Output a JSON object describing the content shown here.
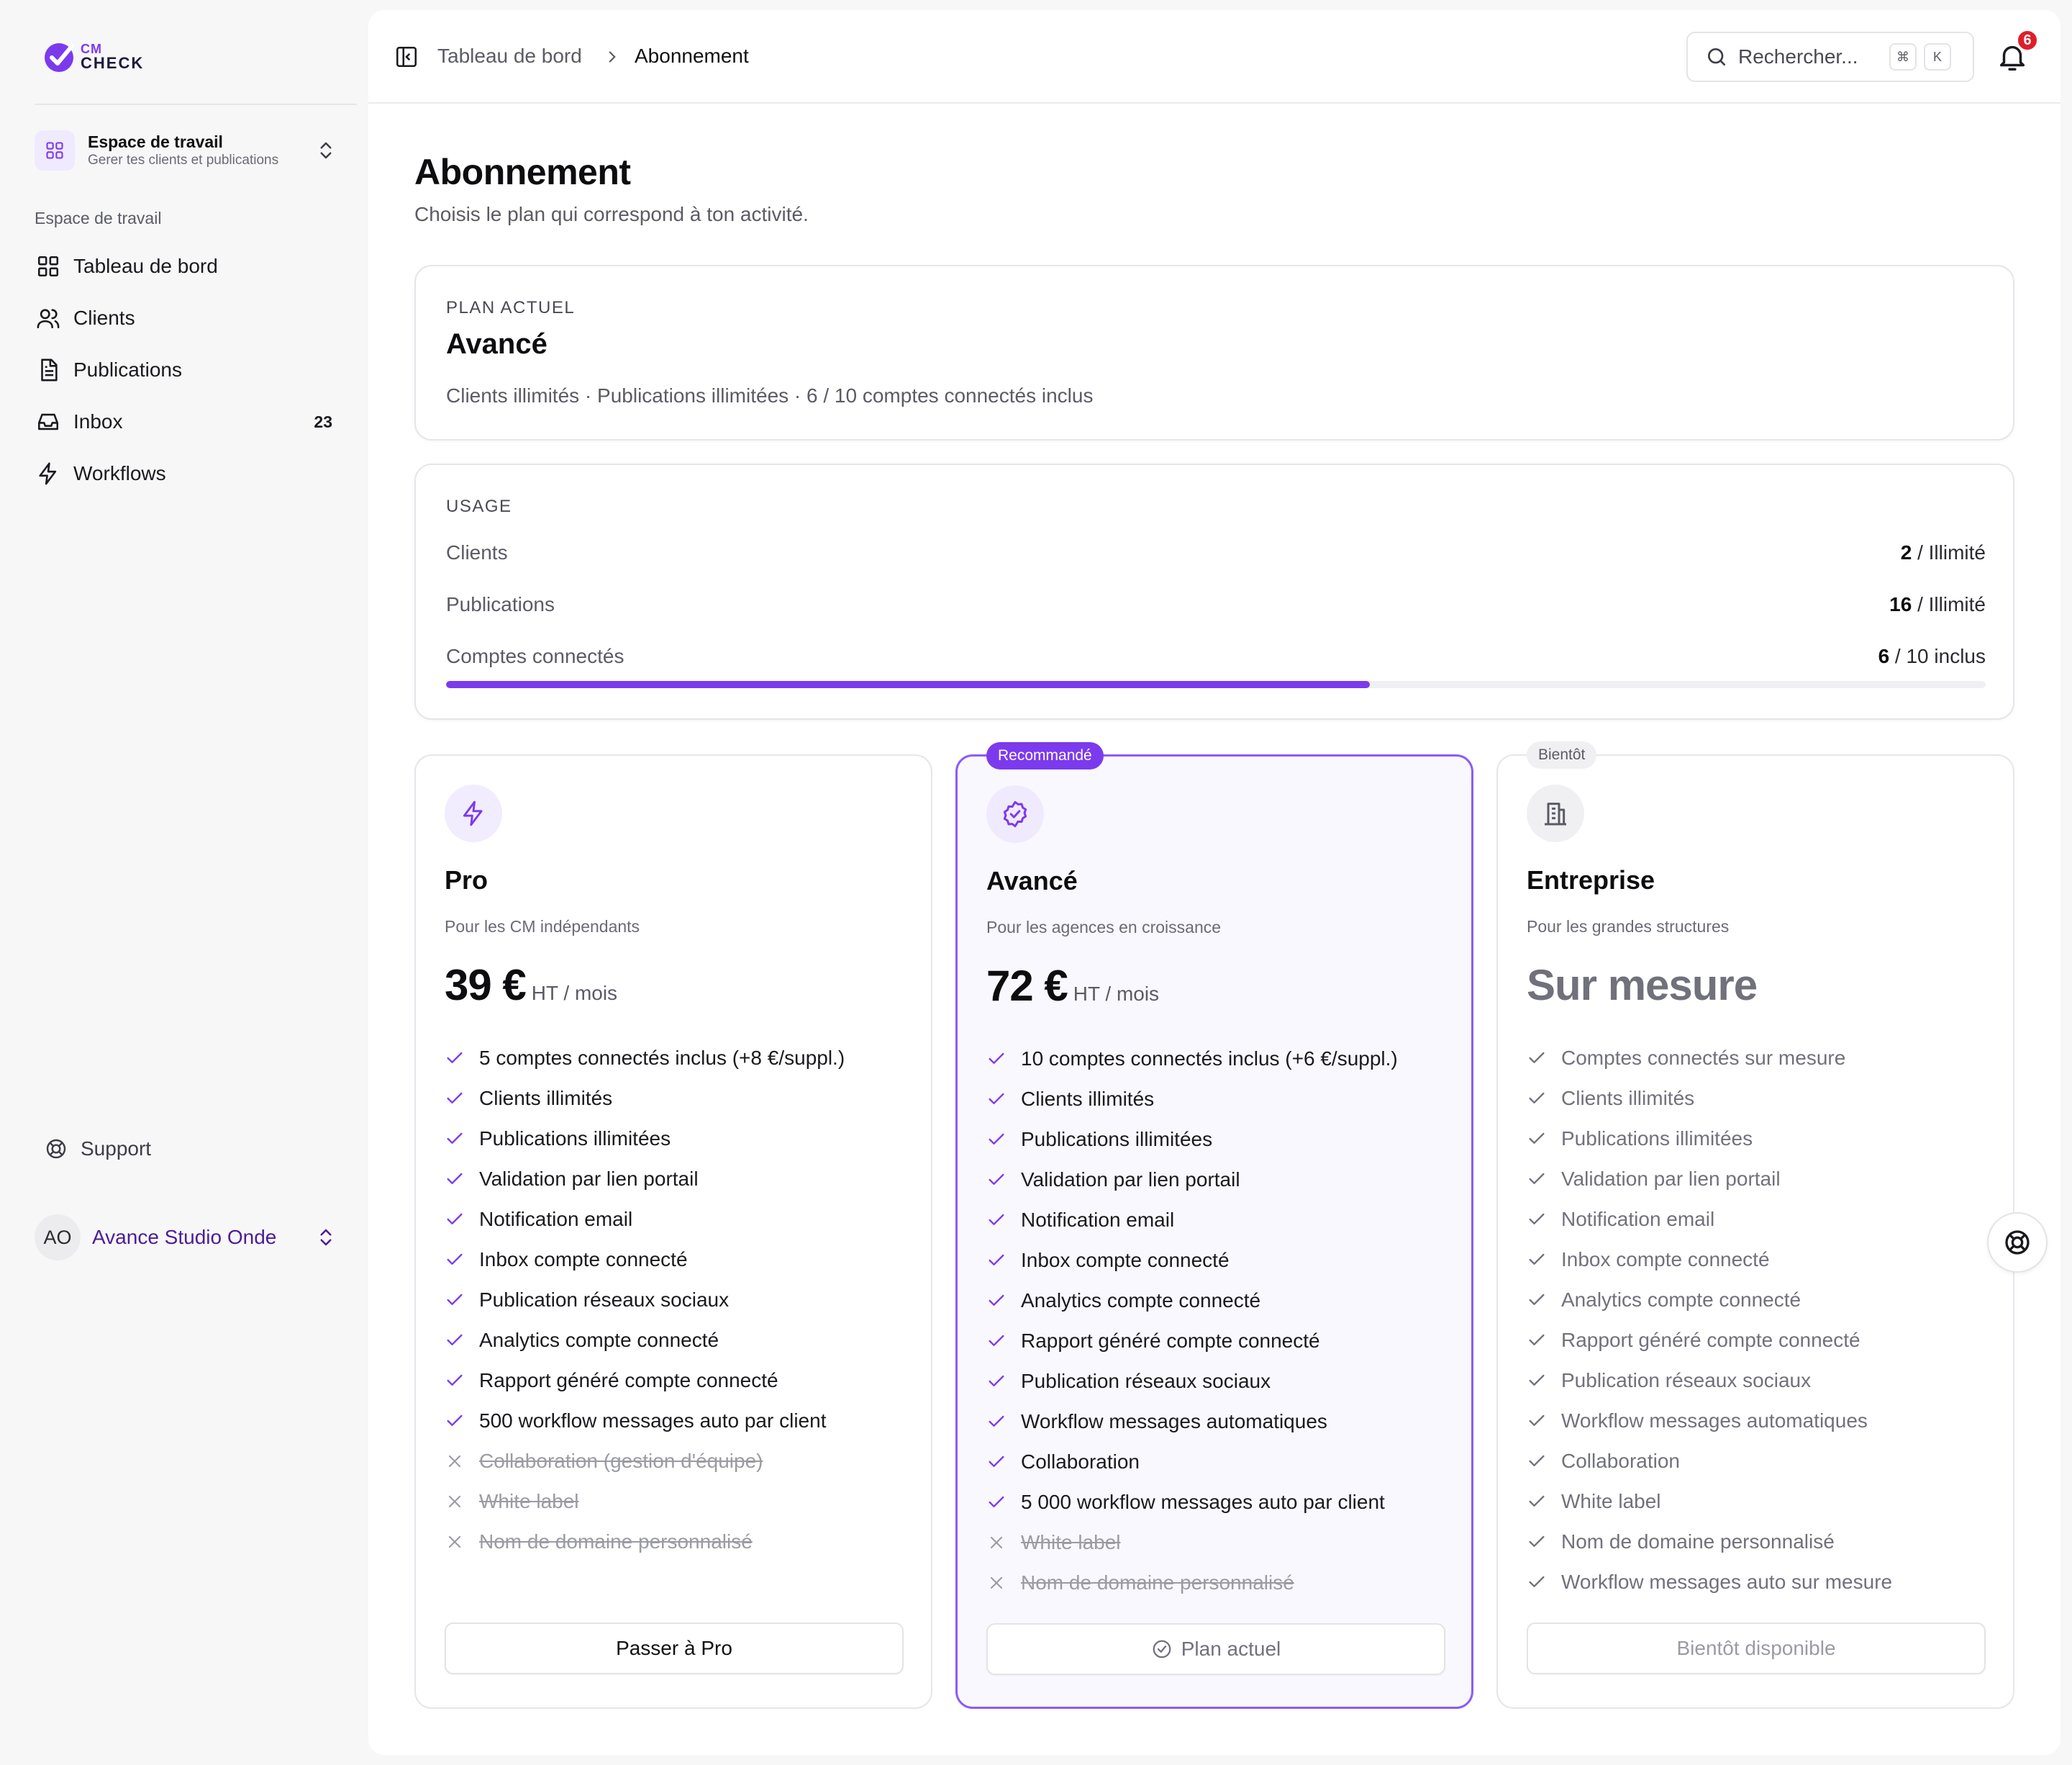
{
  "brand": {
    "line1": "CM",
    "line2": "CHECK",
    "accent": "#7c3aed"
  },
  "workspace": {
    "title": "Espace de travail",
    "subtitle": "Gerer tes clients et publications"
  },
  "sidebar": {
    "section_label": "Espace de travail",
    "items": [
      {
        "label": "Tableau de bord",
        "icon": "dashboard-icon"
      },
      {
        "label": "Clients",
        "icon": "users-icon"
      },
      {
        "label": "Publications",
        "icon": "document-icon"
      },
      {
        "label": "Inbox",
        "icon": "inbox-icon",
        "badge": "23"
      },
      {
        "label": "Workflows",
        "icon": "lightning-icon"
      }
    ],
    "support_label": "Support",
    "user": {
      "initials": "AO",
      "name": "Avance Studio Onde"
    }
  },
  "header": {
    "breadcrumb": [
      "Tableau de bord",
      "Abonnement"
    ],
    "search_placeholder": "Rechercher...",
    "shortcut": [
      "⌘",
      "K"
    ],
    "notifications_count": "6"
  },
  "page": {
    "title": "Abonnement",
    "subtitle": "Choisis le plan qui correspond à ton activité."
  },
  "current_plan": {
    "eyebrow": "PLAN ACTUEL",
    "name": "Avancé",
    "description": "Clients illimités · Publications illimitées · 6 / 10 comptes connectés inclus"
  },
  "usage": {
    "eyebrow": "USAGE",
    "rows": [
      {
        "label": "Clients",
        "used": "2",
        "limit": " / Illimité"
      },
      {
        "label": "Publications",
        "used": "16",
        "limit": " / Illimité"
      },
      {
        "label": "Comptes connectés",
        "used": "6",
        "limit": " / 10 inclus"
      }
    ],
    "connected_accounts_progress": 0.6
  },
  "plans": [
    {
      "name": "Pro",
      "tagline": "Pour les CM indépendants",
      "price": "39 €",
      "period": "HT / mois",
      "button": "Passer à Pro",
      "features": [
        {
          "text": "5 comptes connectés inclus (+8 €/suppl.)",
          "included": true
        },
        {
          "text": "Clients illimités",
          "included": true
        },
        {
          "text": "Publications illimitées",
          "included": true
        },
        {
          "text": "Validation par lien portail",
          "included": true
        },
        {
          "text": "Notification email",
          "included": true
        },
        {
          "text": "Inbox compte connecté",
          "included": true
        },
        {
          "text": "Publication réseaux sociaux",
          "included": true
        },
        {
          "text": "Analytics compte connecté",
          "included": true
        },
        {
          "text": "Rapport généré compte connecté",
          "included": true
        },
        {
          "text": "500 workflow messages auto par client",
          "included": true
        },
        {
          "text": "Collaboration (gestion d'équipe)",
          "included": false
        },
        {
          "text": "White label",
          "included": false
        },
        {
          "text": "Nom de domaine personnalisé",
          "included": false
        }
      ]
    },
    {
      "name": "Avancé",
      "pill": "Recommandé",
      "tagline": "Pour les agences en croissance",
      "price": "72 €",
      "period": "HT / mois",
      "button": "Plan actuel",
      "features": [
        {
          "text": "10 comptes connectés inclus (+6 €/suppl.)",
          "included": true
        },
        {
          "text": "Clients illimités",
          "included": true
        },
        {
          "text": "Publications illimitées",
          "included": true
        },
        {
          "text": "Validation par lien portail",
          "included": true
        },
        {
          "text": "Notification email",
          "included": true
        },
        {
          "text": "Inbox compte connecté",
          "included": true
        },
        {
          "text": "Analytics compte connecté",
          "included": true
        },
        {
          "text": "Rapport généré compte connecté",
          "included": true
        },
        {
          "text": "Publication réseaux sociaux",
          "included": true
        },
        {
          "text": "Workflow messages automatiques",
          "included": true
        },
        {
          "text": "Collaboration",
          "included": true
        },
        {
          "text": "5 000 workflow messages auto par client",
          "included": true
        },
        {
          "text": "White label",
          "included": false
        },
        {
          "text": "Nom de domaine personnalisé",
          "included": false
        }
      ]
    },
    {
      "name": "Entreprise",
      "pill": "Bientôt",
      "tagline": "Pour les grandes structures",
      "price": "Sur mesure",
      "button": "Bientôt disponible",
      "features": [
        {
          "text": "Comptes connectés sur mesure",
          "included": true
        },
        {
          "text": "Clients illimités",
          "included": true
        },
        {
          "text": "Publications illimitées",
          "included": true
        },
        {
          "text": "Validation par lien portail",
          "included": true
        },
        {
          "text": "Notification email",
          "included": true
        },
        {
          "text": "Inbox compte connecté",
          "included": true
        },
        {
          "text": "Analytics compte connecté",
          "included": true
        },
        {
          "text": "Rapport généré compte connecté",
          "included": true
        },
        {
          "text": "Publication réseaux sociaux",
          "included": true
        },
        {
          "text": "Workflow messages automatiques",
          "included": true
        },
        {
          "text": "Collaboration",
          "included": true
        },
        {
          "text": "White label",
          "included": true
        },
        {
          "text": "Nom de domaine personnalisé",
          "included": true
        },
        {
          "text": "Workflow messages auto sur mesure",
          "included": true
        }
      ]
    }
  ]
}
